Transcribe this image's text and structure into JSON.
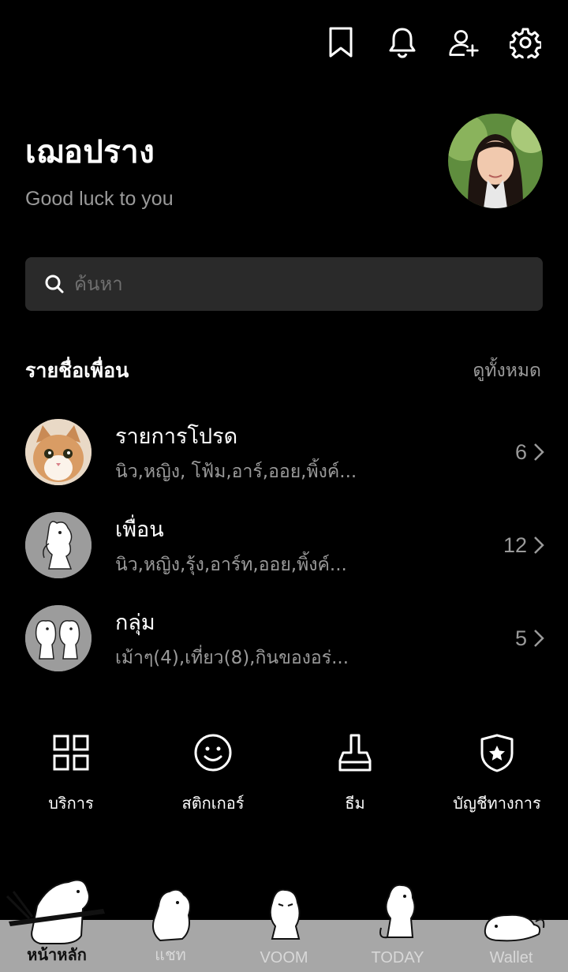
{
  "profile": {
    "name": "เฌอปราง",
    "status": "Good luck to you"
  },
  "header_icons": [
    "bookmark-icon",
    "bell-icon",
    "add-friend-icon",
    "gear-icon"
  ],
  "search": {
    "placeholder": "ค้นหา"
  },
  "friends_section": {
    "title": "รายชื่อเพื่อน",
    "see_all": "ดูทั้งหมด"
  },
  "rows": [
    {
      "title": "รายการโปรด",
      "subtitle": "นิว,หญิง, โฟ้ม,อาร์,ออย,พิ้งค์...",
      "count": "6"
    },
    {
      "title": "เพื่อน",
      "subtitle": "นิว,หญิง,รุ้ง,อาร์ท,ออย,พิ้งค์...",
      "count": "12"
    },
    {
      "title": "กลุ่ม",
      "subtitle": "เม้าๆ(4),เที่ยว(8),กินของอร่...",
      "count": "5"
    }
  ],
  "quick_actions": [
    {
      "label": "บริการ",
      "icon": "grid-icon"
    },
    {
      "label": "สติกเกอร์",
      "icon": "smiley-icon"
    },
    {
      "label": "ธีม",
      "icon": "brush-icon"
    },
    {
      "label": "บัญชีทางการ",
      "icon": "shield-star-icon"
    }
  ],
  "tabs": [
    {
      "label": "หน้าหลัก",
      "active": true
    },
    {
      "label": "แชท",
      "active": false
    },
    {
      "label": "VOOM",
      "active": false
    },
    {
      "label": "TODAY",
      "active": false
    },
    {
      "label": "Wallet",
      "active": false
    }
  ],
  "colors": {
    "background": "#000000",
    "search_bg": "#2a2a2a",
    "muted_text": "#9a9a9a",
    "tab_bar": "#a7a7a7"
  }
}
